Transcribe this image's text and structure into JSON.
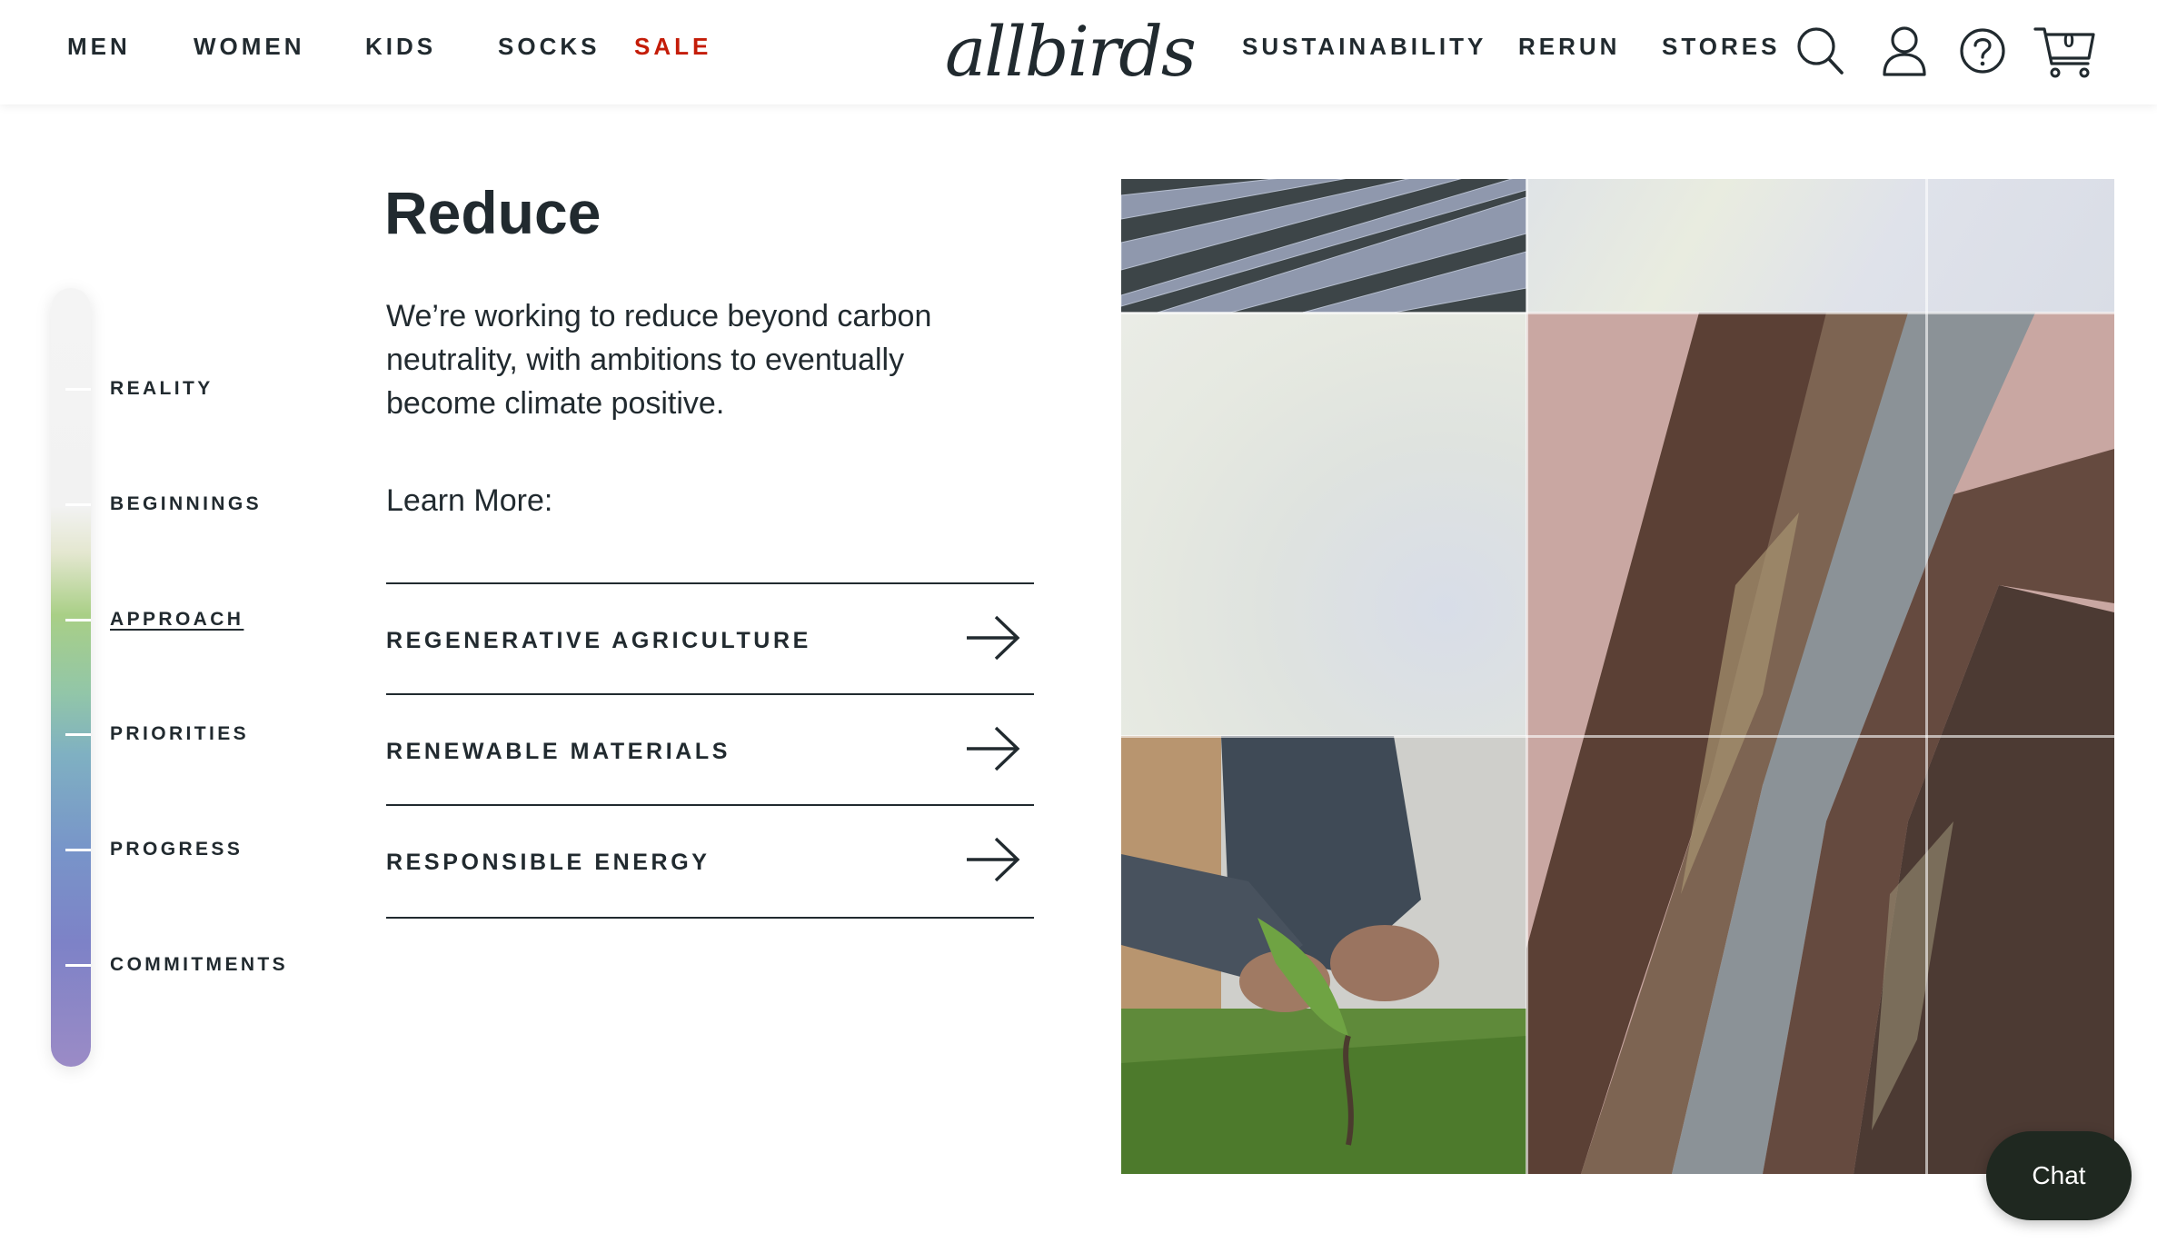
{
  "header": {
    "nav_left": [
      "MEN",
      "WOMEN",
      "KIDS",
      "SOCKS",
      "SALE"
    ],
    "logo": "allbirds",
    "nav_right": [
      "SUSTAINABILITY",
      "RERUN",
      "STORES"
    ],
    "icons": [
      "search-icon",
      "account-icon",
      "help-icon",
      "cart-icon"
    ],
    "cart_count": "0"
  },
  "timeline": {
    "items": [
      "REALITY",
      "BEGINNINGS",
      "APPROACH",
      "PRIORITIES",
      "PROGRESS",
      "COMMITMENTS"
    ],
    "active": "APPROACH"
  },
  "main": {
    "title": "Reduce",
    "description": "We’re working to reduce beyond carbon neutrality, with ambitions to eventually become climate positive.",
    "learn_more": "Learn More:",
    "links": [
      "REGENERATIVE AGRICULTURE",
      "RENEWABLE MATERIALS",
      "RESPONSIBLE ENERGY"
    ]
  },
  "chat": {
    "label": "Chat"
  },
  "colors": {
    "text": "#212a2f",
    "sale": "#c41c08",
    "chat_bg": "#1f2820"
  }
}
